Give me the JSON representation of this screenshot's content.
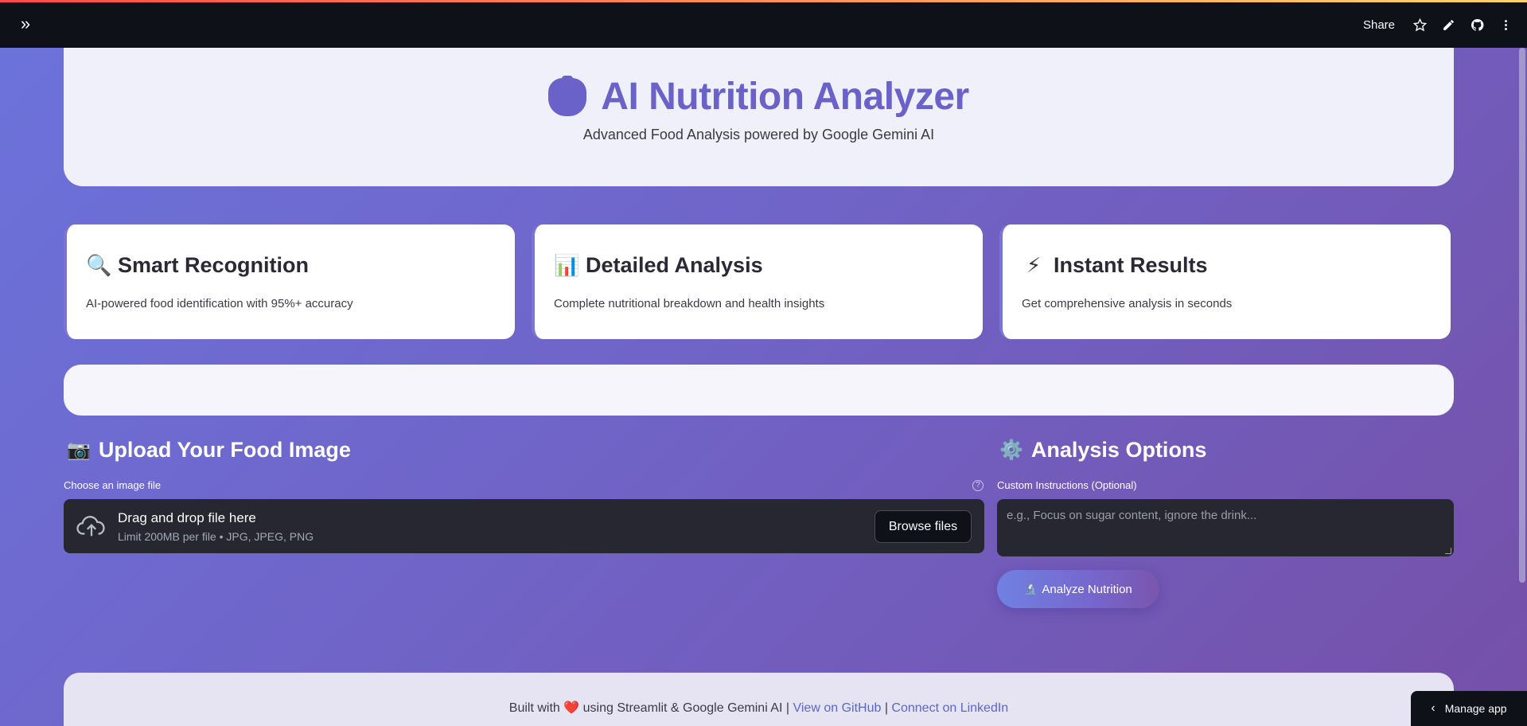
{
  "toolbar": {
    "share_label": "Share"
  },
  "hero": {
    "title": "AI Nutrition Analyzer",
    "subtitle": "Advanced Food Analysis powered by Google Gemini AI"
  },
  "features": [
    {
      "emoji": "🔍",
      "title": "Smart Recognition",
      "desc": "AI-powered food identification with 95%+ accuracy"
    },
    {
      "emoji": "📊",
      "title": "Detailed Analysis",
      "desc": "Complete nutritional breakdown and health insights"
    },
    {
      "emoji": "⚡",
      "title": "Instant Results",
      "desc": "Get comprehensive analysis in seconds"
    }
  ],
  "upload": {
    "emoji": "📷",
    "heading": "Upload Your Food Image",
    "label": "Choose an image file",
    "drop_text": "Drag and drop file here",
    "limit_text": "Limit 200MB per file • JPG, JPEG, PNG",
    "browse_label": "Browse files"
  },
  "options": {
    "emoji": "⚙️",
    "heading": "Analysis Options",
    "instructions_label": "Custom Instructions (Optional)",
    "instructions_placeholder": "e.g., Focus on sugar content, ignore the drink...",
    "analyze_emoji": "🔬",
    "analyze_label": "Analyze Nutrition"
  },
  "footer": {
    "built_with": "Built with",
    "heart": "❤️",
    "using": "using Streamlit & Google Gemini AI |",
    "github_label": "View on GitHub",
    "separator": "|",
    "linkedin_label": "Connect on LinkedIn"
  },
  "manage_app": {
    "label": "Manage app"
  },
  "colors": {
    "accent": "#6a62c8",
    "topbar": "#0e1117",
    "widget_bg": "#262730",
    "link": "#5a66cf"
  }
}
